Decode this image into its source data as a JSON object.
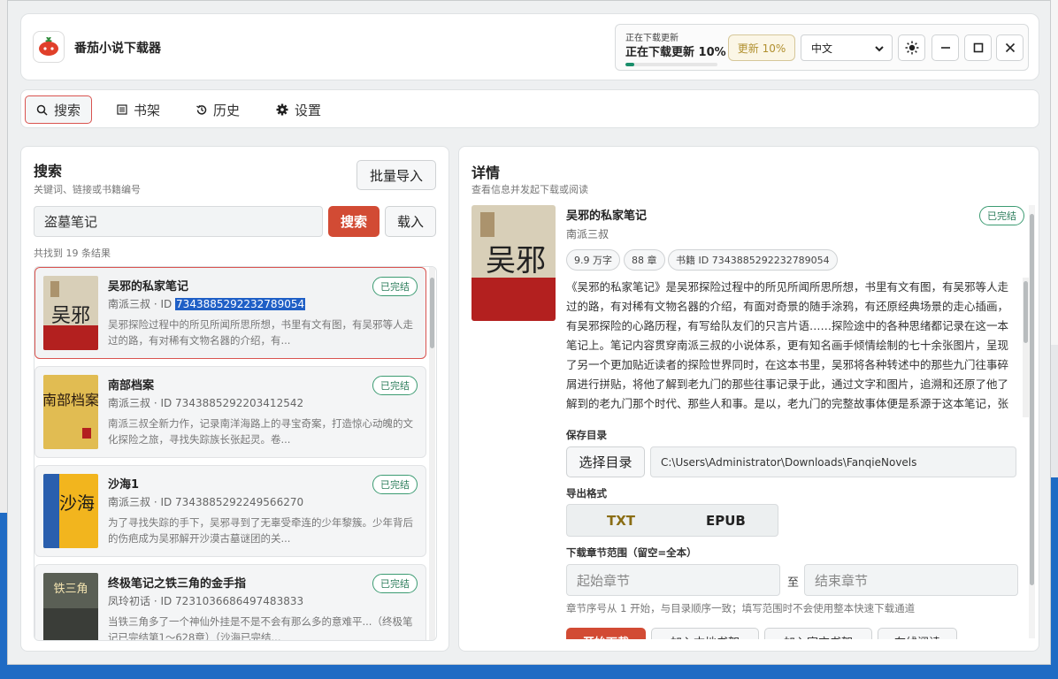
{
  "app": {
    "title": "番茄小说下载器",
    "status_small": "正在下载更新",
    "status_main": "正在下载更新 10%",
    "status_progress": 0.1,
    "update_button": "更新 10%",
    "language": "中文"
  },
  "nav": [
    {
      "label": "搜索",
      "icon": "search-icon"
    },
    {
      "label": "书架",
      "icon": "list-icon"
    },
    {
      "label": "历史",
      "icon": "history-icon"
    },
    {
      "label": "设置",
      "icon": "gear-icon"
    }
  ],
  "search": {
    "title": "搜索",
    "subtitle": "关键词、链接或书籍编号",
    "batch_import": "批量导入",
    "query": "盗墓笔记",
    "search_button": "搜索",
    "load_button": "载入",
    "count": "共找到 19 条结果",
    "results": [
      {
        "title": "吴邪的私家笔记",
        "author": "南派三叔 · ID ",
        "id": "7343885292232789054",
        "desc": "吴邪探险过程中的所见所闻所思所想，书里有文有图，有吴邪等人走过的路，有对稀有文物名器的介绍，有...",
        "status": "已完结",
        "cover_text": "吴邪"
      },
      {
        "title": "南部档案",
        "author": "南派三叔 · ID ",
        "id": "7343885292203412542",
        "desc": "南派三叔全新力作，记录南洋海路上的寻宝奇案，打造惊心动魄的文化探险之旅，寻找失踪族长张起灵。卷...",
        "status": "已完结",
        "cover_text": "南部档案"
      },
      {
        "title": "沙海1",
        "author": "南派三叔 · ID ",
        "id": "7343885292249566270",
        "desc": "为了寻找失踪的手下，吴邪寻到了无辜受牵连的少年黎簇。少年背后的伤疤成为吴邪解开沙漠古墓谜团的关...",
        "status": "已完结",
        "cover_text": "沙海"
      },
      {
        "title": "终极笔记之铁三角的金手指",
        "author": "凤玲初话 · ID ",
        "id": "7231036686497483833",
        "desc": "当铁三角多了一个神仙外挂是不是不会有那么多的意难平...（终极笔记已完结第1～628章）（沙海已完结...",
        "status": "已完结",
        "cover_text": "铁三角"
      }
    ]
  },
  "detail": {
    "title": "详情",
    "subtitle": "查看信息并发起下载或阅读",
    "book_title": "吴邪的私家笔记",
    "author": "南派三叔",
    "status": "已完结",
    "chips": [
      "9.9 万字",
      "88 章",
      "书籍 ID 7343885292232789054"
    ],
    "description": "《吴邪的私家笔记》是吴邪探险过程中的所见所闻所思所想，书里有文有图，有吴邪等人走过的路，有对稀有文物名器的介绍，有面对奇景的随手涂鸦，有还原经典场景的走心插画，有吴邪探险的心路历程，有写给队友们的只言片语……探险途中的各种思绪都记录在这一本笔记上。笔记内容贯穿南派三叔的小说体系，更有知名画手倾情绘制的七十余张图片，呈现了另一个更加贴近读者的探险世界同时，在这本书里，吴邪将各种转述中的那些九门往事碎屑进行拼贴，将他了解到老九门的那些往事记录于此，通过文字和图片，追溯和还原了他了解到的老九门那个时代、那些人和事。是以，老九门的完整故事体便是系源于这本笔记，张启山、二月红这些鲜活的人物也由此开启。",
    "save_dir_label": "保存目录",
    "choose_dir": "选择目录",
    "save_path": "C:\\Users\\Administrator\\Downloads\\FanqieNovels",
    "format_label": "导出格式",
    "formats": [
      "TXT",
      "EPUB"
    ],
    "range_label": "下载章节范围（留空=全本）",
    "start_placeholder": "起始章节",
    "range_sep": "至",
    "end_placeholder": "结束章节",
    "hint": "章节序号从 1 开始，与目录顺序一致；填写范围时不会使用整本快速下载通道",
    "actions": [
      "开始下载",
      "加入本地书架",
      "加入官方书架",
      "在线阅读"
    ]
  },
  "colors": {
    "accent_red": "#d24b34",
    "done_green": "#2e7e5c",
    "update_gold": "#b1902f",
    "txt_gold": "#8a6d14"
  }
}
